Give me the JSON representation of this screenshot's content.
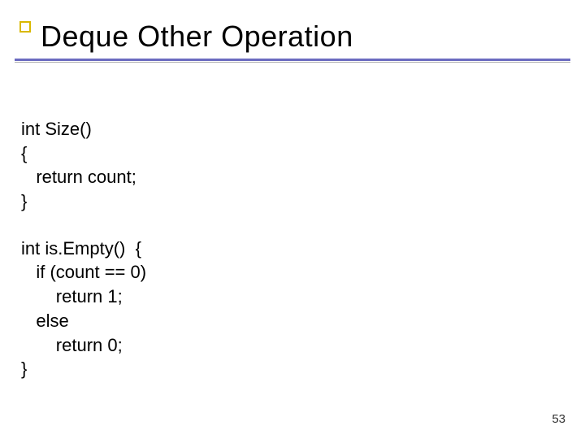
{
  "slide": {
    "title": "Deque Other Operation",
    "code_block_1": "int Size()\n{\n   return count;\n}",
    "code_block_2": "int is.Empty()  {\n   if (count == 0)\n       return 1;\n   else\n       return 0;\n}",
    "page_number": "53"
  }
}
